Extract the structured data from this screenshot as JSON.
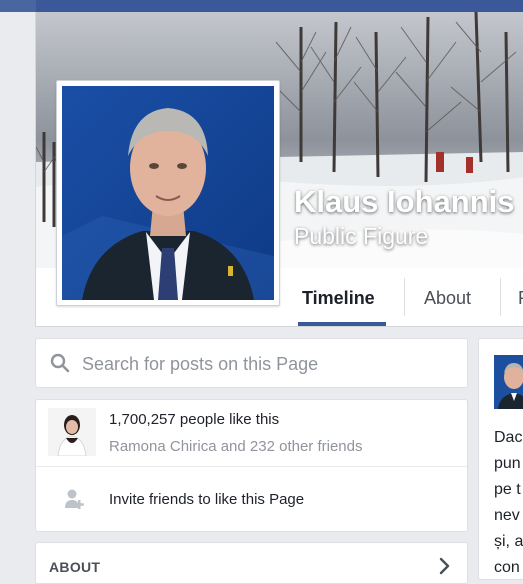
{
  "page": {
    "name": "Klaus Iohannis",
    "category": "Public Figure"
  },
  "tabs": [
    {
      "label": "Timeline",
      "active": true
    },
    {
      "label": "About",
      "active": false
    },
    {
      "label": "P",
      "active": false
    }
  ],
  "search": {
    "placeholder": "Search for posts on this Page",
    "value": ""
  },
  "likes": {
    "count_text": "1,700,257 people like this",
    "friends_text": "Ramona Chirica and 232 other friends",
    "invite_text": "Invite friends to like this Page"
  },
  "about": {
    "title": "ABOUT"
  },
  "post_preview": {
    "lines": [
      "Dac",
      "pun",
      "pe t",
      "nev",
      "și, a",
      "con"
    ]
  },
  "colors": {
    "brand": "#3b5998",
    "background": "#e9ebee",
    "secondary_text": "#90949c"
  },
  "icons": {
    "search": "magnifier",
    "invite": "person-plus",
    "about_arrow": "chevron-right"
  }
}
